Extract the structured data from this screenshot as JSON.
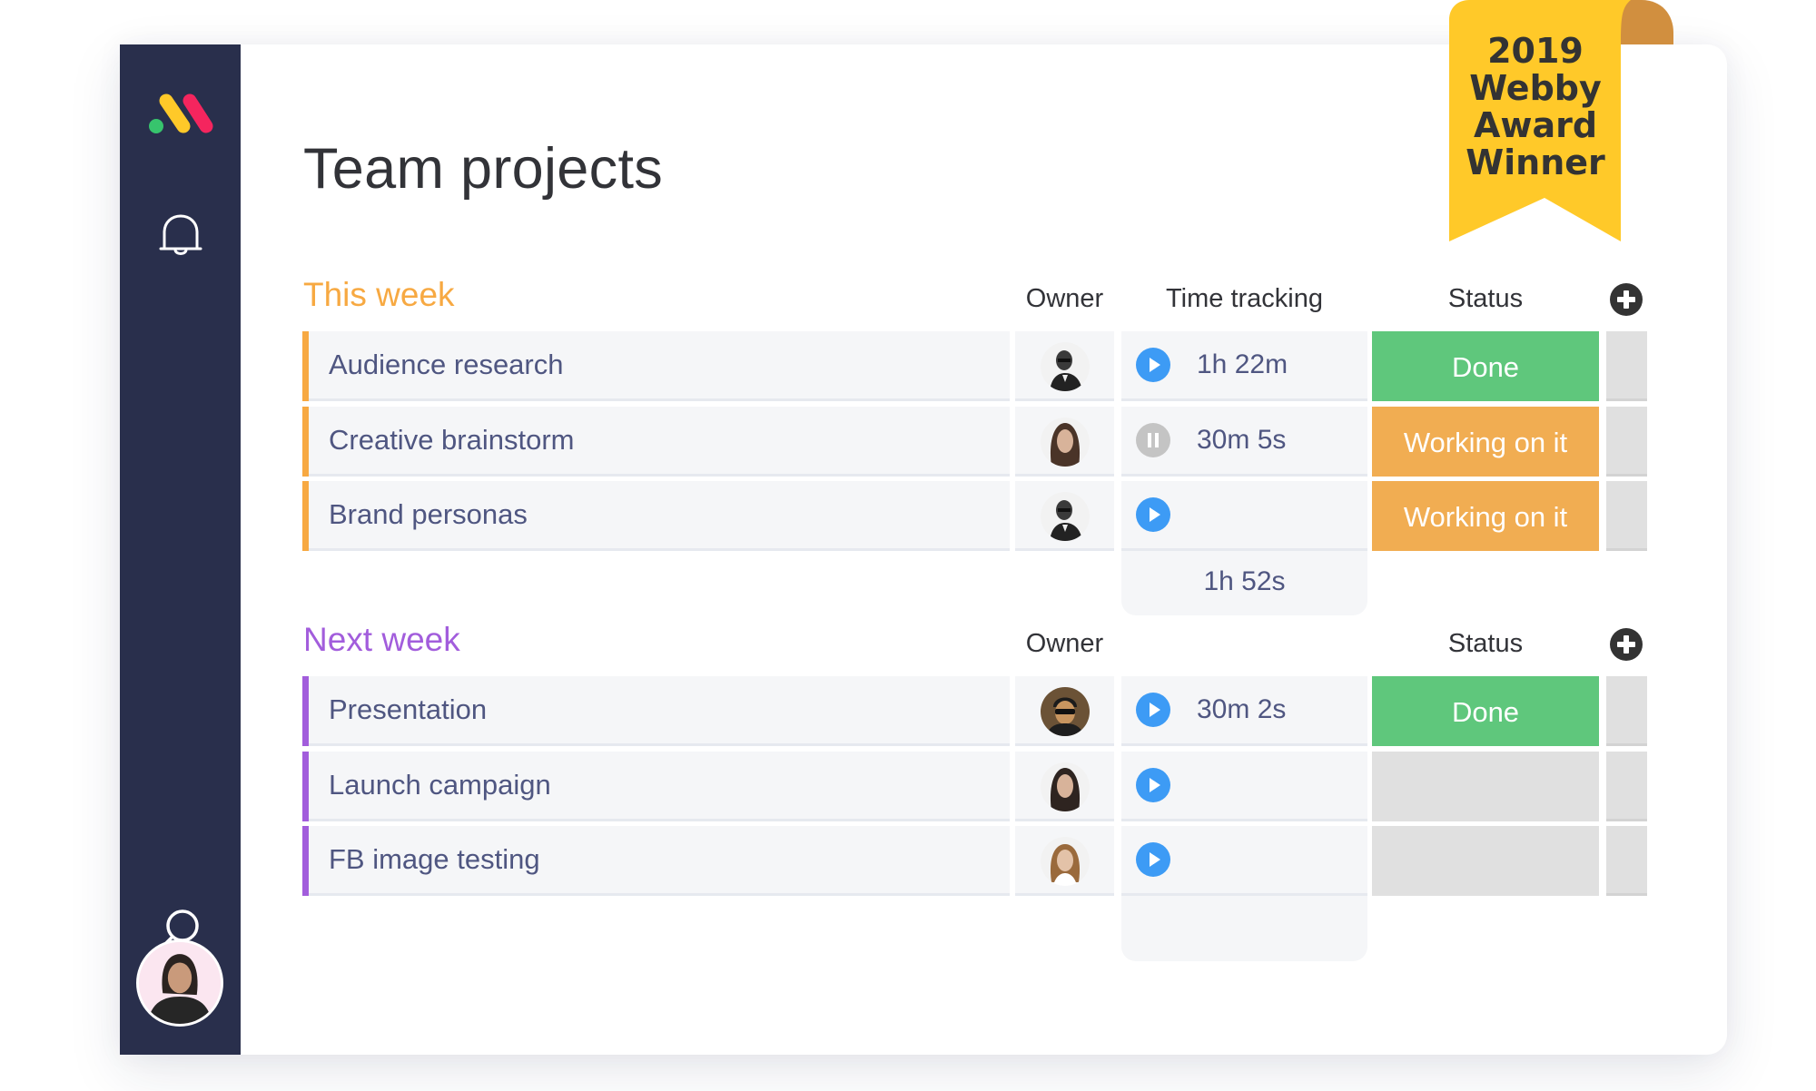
{
  "page": {
    "title": "Team projects"
  },
  "sidebar": {
    "logo": "monday-logo-icon",
    "icons": [
      "bell-icon",
      "search-icon"
    ],
    "avatar": "user-avatar"
  },
  "badge": {
    "lines": [
      "2019",
      "Webby",
      "Award",
      "Winner"
    ]
  },
  "colors": {
    "sidebar": "#292f4c",
    "this_week": "#f7a942",
    "next_week": "#a25ddc",
    "done": "#5fc77c",
    "working": "#f1ad52",
    "empty_status": "#e0e0e0",
    "play": "#3d9bf5",
    "pause": "#c4c4c4",
    "badge_yellow": "#ffc929",
    "badge_curl": "#d18f3f"
  },
  "groups": [
    {
      "title": "This week",
      "columns": {
        "owner": "Owner",
        "time": "Time tracking",
        "status": "Status"
      },
      "rows": [
        {
          "name": "Audience research",
          "owner": "man-with-glasses",
          "timer": "play",
          "time": "1h 22m",
          "status": "Done"
        },
        {
          "name": "Creative brainstorm",
          "owner": "woman-long-hair",
          "timer": "pause",
          "time": "30m 5s",
          "status": "Working on it"
        },
        {
          "name": "Brand personas",
          "owner": "man-with-glasses",
          "timer": "play",
          "time": "",
          "status": "Working on it"
        }
      ],
      "time_total": "1h 52s"
    },
    {
      "title": "Next week",
      "columns": {
        "owner": "Owner",
        "time": "",
        "status": "Status"
      },
      "rows": [
        {
          "name": "Presentation",
          "owner": "man-sunglasses",
          "timer": "play",
          "time": "30m 2s",
          "status": "Done"
        },
        {
          "name": "Launch campaign",
          "owner": "woman-long-hair",
          "timer": "play",
          "time": "",
          "status": ""
        },
        {
          "name": "FB image testing",
          "owner": "woman-blonde",
          "timer": "play",
          "time": "",
          "status": ""
        }
      ],
      "time_total": ""
    }
  ]
}
